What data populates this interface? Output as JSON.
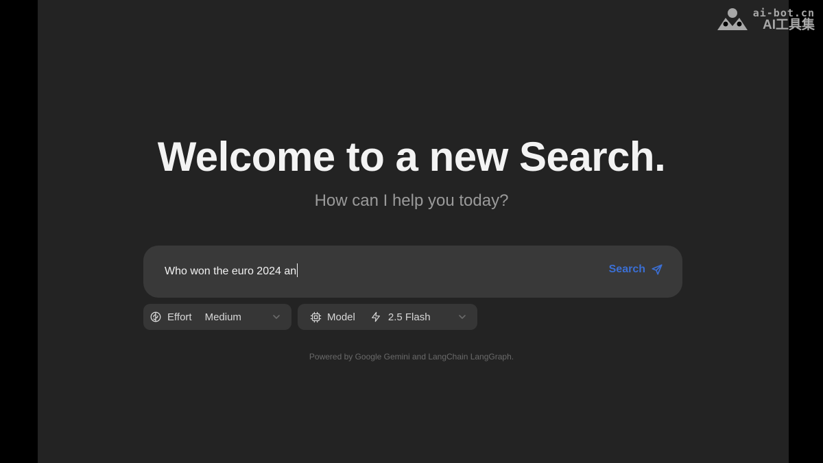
{
  "colors": {
    "background": "#232323",
    "outer": "#000000",
    "search_box": "#393939",
    "pill": "#363636",
    "accent": "#3b6fd4"
  },
  "hero": {
    "title": "Welcome to a new Search.",
    "subtitle": "How can I help you today?"
  },
  "search": {
    "query": "Who won the euro 2024 an",
    "button_label": "Search",
    "button_icon": "send-icon"
  },
  "effort": {
    "icon": "brain-icon",
    "label": "Effort",
    "selected": "Medium"
  },
  "model": {
    "icon": "cpu-icon",
    "label": "Model",
    "selected_icon": "zap-icon",
    "selected": "2.5 Flash"
  },
  "footer": {
    "text": "Powered by Google Gemini and LangChain LangGraph."
  },
  "watermark": {
    "domain": "ai-bot.cn",
    "name": "AI工具集"
  }
}
